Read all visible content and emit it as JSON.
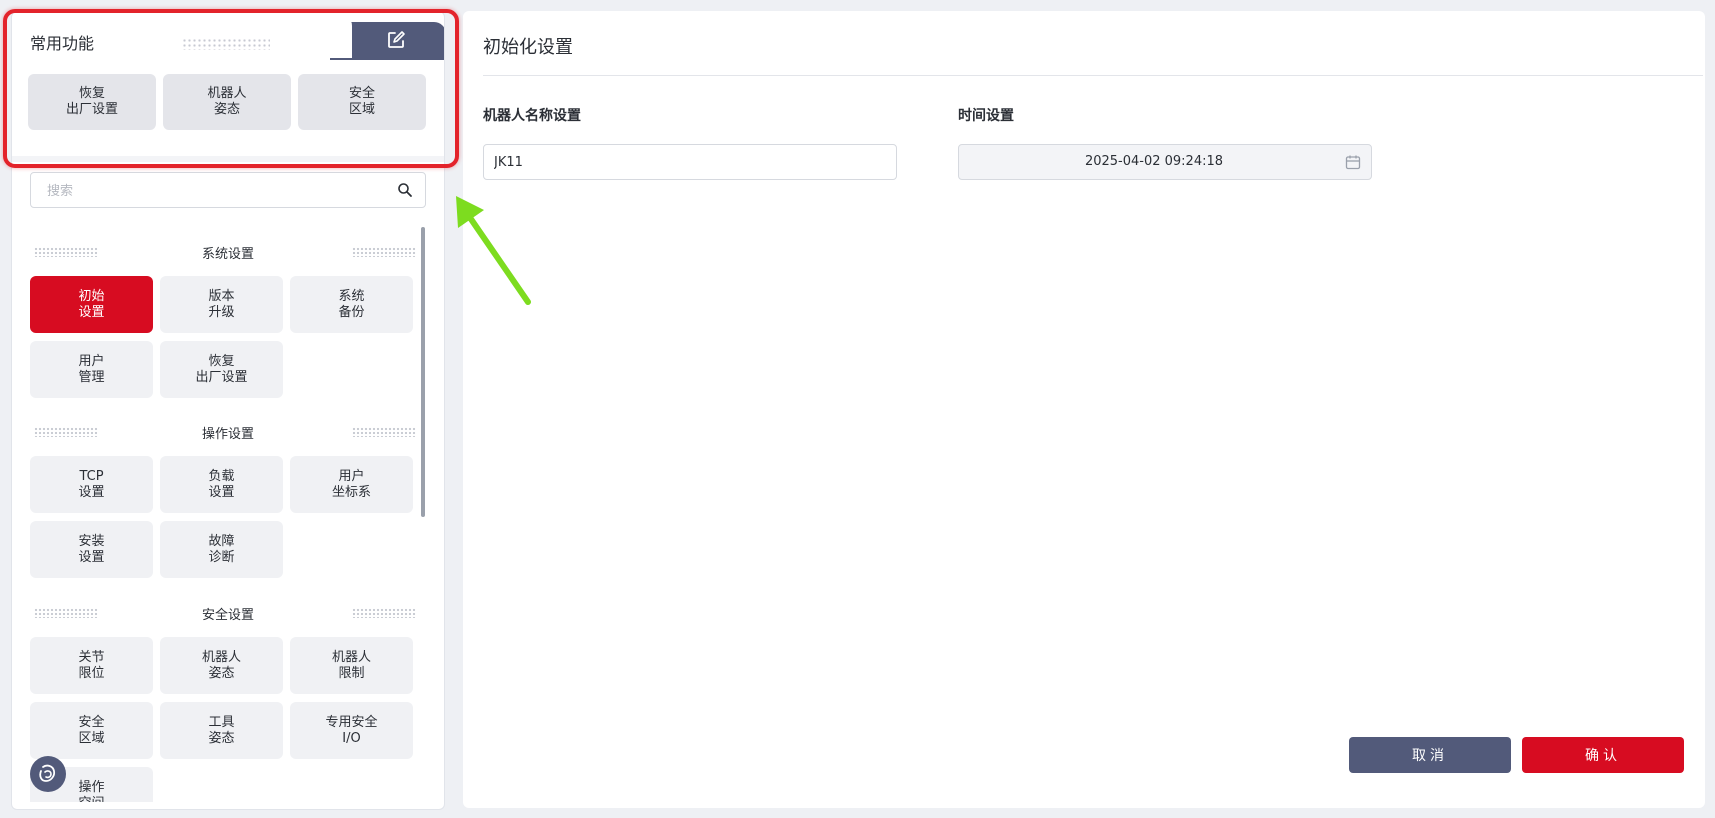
{
  "favorites": {
    "title": "常用功能",
    "items": [
      {
        "line1": "恢复",
        "line2": "出厂设置"
      },
      {
        "line1": "机器人",
        "line2": "姿态"
      },
      {
        "line1": "安全",
        "line2": "区域"
      }
    ]
  },
  "search": {
    "placeholder": "搜索",
    "value": ""
  },
  "sections": [
    {
      "title": "系统设置",
      "items": [
        {
          "line1": "初始",
          "line2": "设置",
          "active": true
        },
        {
          "line1": "版本",
          "line2": "升级"
        },
        {
          "line1": "系统",
          "line2": "备份"
        },
        {
          "line1": "用户",
          "line2": "管理"
        },
        {
          "line1": "恢复",
          "line2": "出厂设置"
        }
      ]
    },
    {
      "title": "操作设置",
      "items": [
        {
          "line1": "TCP",
          "line2": "设置"
        },
        {
          "line1": "负载",
          "line2": "设置"
        },
        {
          "line1": "用户",
          "line2": "坐标系"
        },
        {
          "line1": "安装",
          "line2": "设置"
        },
        {
          "line1": "故障",
          "line2": "诊断"
        }
      ]
    },
    {
      "title": "安全设置",
      "items": [
        {
          "line1": "关节",
          "line2": "限位"
        },
        {
          "line1": "机器人",
          "line2": "姿态"
        },
        {
          "line1": "机器人",
          "line2": "限制"
        },
        {
          "line1": "安全",
          "line2": "区域"
        },
        {
          "line1": "工具",
          "line2": "姿态"
        },
        {
          "line1": "专用安全",
          "line2": "I/O"
        },
        {
          "line1": "操作",
          "line2": "空间"
        }
      ]
    }
  ],
  "main": {
    "title": "初始化设置",
    "robot_name_label": "机器人名称设置",
    "robot_name_value": "JK11",
    "time_label": "时间设置",
    "time_value": "2025-04-02 09:24:18",
    "cancel_label": "取消",
    "confirm_label": "确认"
  },
  "colors": {
    "accent_red": "#d70c21",
    "secondary": "#525a7a",
    "annotation_box": "#e3232b",
    "annotation_arrow": "#7ddc1f"
  },
  "icons": [
    "edit-icon",
    "search-icon",
    "calendar-icon",
    "assistant-icon"
  ]
}
